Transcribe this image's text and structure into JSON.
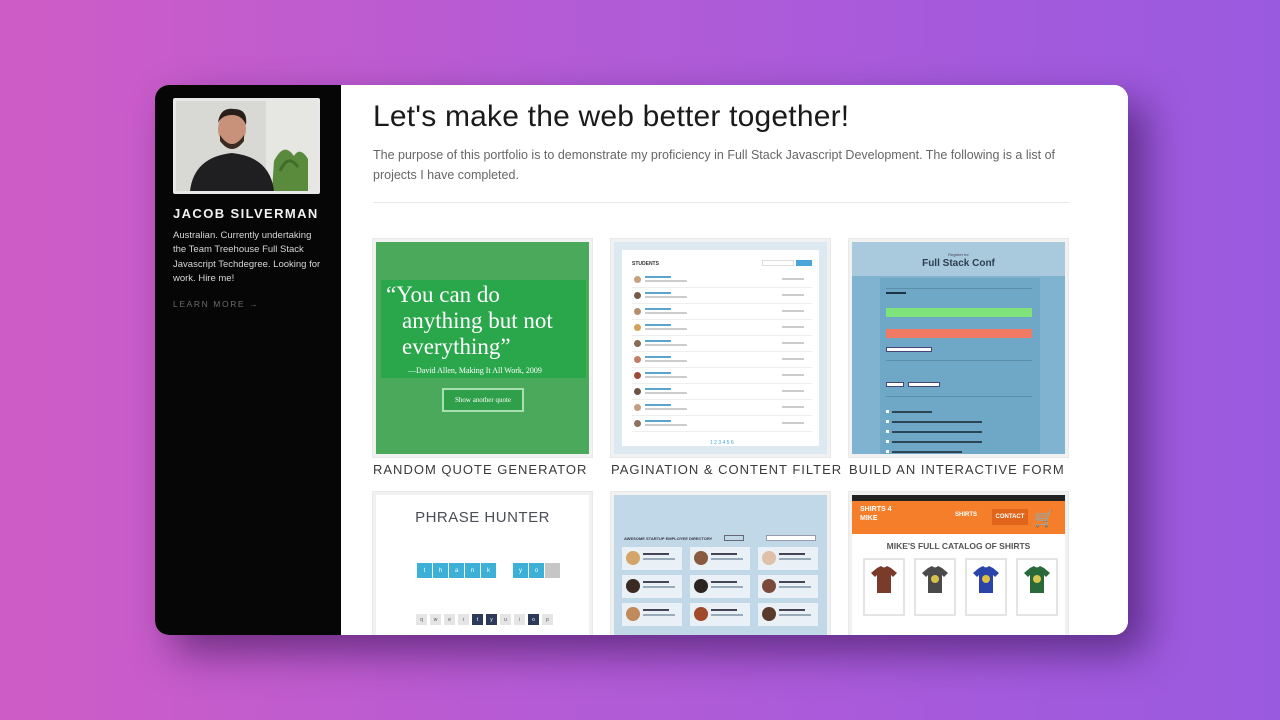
{
  "profile": {
    "name": "JACOB SILVERMAN",
    "bio": "Australian. Currently undertaking the Team Treehouse Full Stack Javascript Techdegree. Looking for work. Hire me!",
    "learn_more": "LEARN MORE →"
  },
  "main": {
    "title": "Let's make the web better together!",
    "description": "The purpose of this portfolio is to demonstrate my proficiency in Full Stack Javascript Development. The following is a list of projects I have completed."
  },
  "projects": [
    {
      "label": "RANDOM QUOTE GENERATOR"
    },
    {
      "label": "PAGINATION & CONTENT FILTER"
    },
    {
      "label": "BUILD AN INTERACTIVE FORM"
    },
    {
      "label": ""
    },
    {
      "label": ""
    },
    {
      "label": ""
    }
  ],
  "thumb_quote": {
    "quote_line1": "“You can do",
    "quote_line2": "anything but not",
    "quote_line3": "everything”",
    "attribution": "—David Allen, Making It All Work, 2009",
    "button": "Show another quote"
  },
  "thumb_pagination": {
    "heading": "STUDENTS",
    "pages": "1 2 3 4 5 6"
  },
  "thumb_form": {
    "kicker": "Register for",
    "heading": "Full Stack Conf"
  },
  "thumb_phrase": {
    "heading": "PHRASE HUNTER",
    "tiles": [
      "t",
      "h",
      "a",
      "n",
      "k",
      "",
      "y",
      "o",
      ""
    ],
    "keys": [
      "q",
      "w",
      "e",
      "r",
      "t",
      "y",
      "u",
      "i",
      "o",
      "p"
    ]
  },
  "thumb_directory": {
    "heading": "AWESOME STARTUP EMPLOYEE DIRECTORY"
  },
  "thumb_shirts": {
    "logo": "SHIRTS 4 MIKE",
    "nav_shirts": "SHIRTS",
    "nav_contact": "CONTACT",
    "heading": "MIKE'S FULL CATALOG OF SHIRTS"
  },
  "colors": {
    "sidebar": "#060606",
    "quote_green": "#2aa64b",
    "form_blue": "#7fb3cf",
    "shirts_orange": "#f47e2a",
    "accent_blue": "#3cb0d7"
  }
}
